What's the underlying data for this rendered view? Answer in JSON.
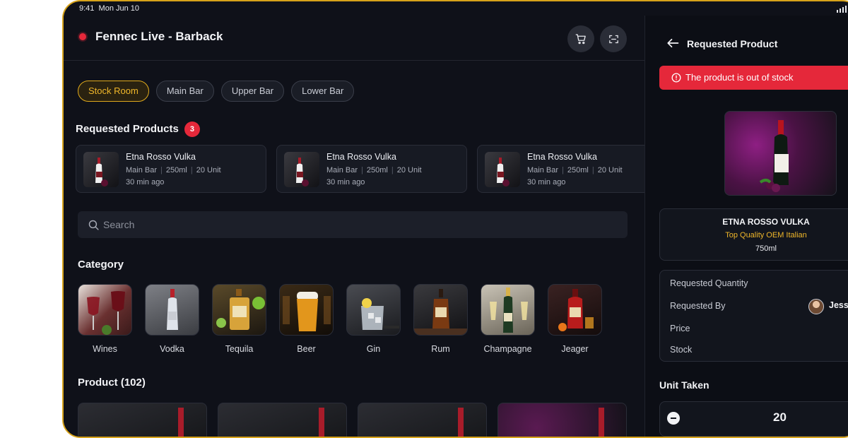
{
  "status_bar": {
    "time": "9:41",
    "date": "Mon Jun 10"
  },
  "header": {
    "title": "Fennec Live - Barback",
    "cart_icon": "cart-icon",
    "scan_icon": "scan-icon"
  },
  "locations": [
    {
      "label": "Stock Room",
      "active": true
    },
    {
      "label": "Main Bar",
      "active": false
    },
    {
      "label": "Upper Bar",
      "active": false
    },
    {
      "label": "Lower Bar",
      "active": false
    }
  ],
  "requested": {
    "title": "Requested Products",
    "count": "3",
    "items": [
      {
        "name": "Etna Rosso Vulka",
        "location": "Main Bar",
        "volume": "250ml",
        "units": "20 Unit",
        "time": "30 min ago"
      },
      {
        "name": "Etna Rosso Vulka",
        "location": "Main Bar",
        "volume": "250ml",
        "units": "20 Unit",
        "time": "30 min ago"
      },
      {
        "name": "Etna Rosso Vulka",
        "location": "Main Bar",
        "volume": "250ml",
        "units": "20 Unit",
        "time": "30 min ago"
      }
    ]
  },
  "search": {
    "placeholder": "Search"
  },
  "category": {
    "title": "Category",
    "items": [
      "Wines",
      "Vodka",
      "Tequila",
      "Beer",
      "Gin",
      "Rum",
      "Champagne",
      "Jeager"
    ]
  },
  "products": {
    "title": "Product (102)"
  },
  "panel": {
    "title": "Requested Product",
    "alert": "The product is out of stock",
    "product_name": "ETNA ROSSO VULKA",
    "product_subtitle": "Top Quality OEM Italian",
    "product_size": "750ml",
    "labels": {
      "requested_quantity": "Requested Quantity",
      "requested_by": "Requested By",
      "price": "Price",
      "stock": "Stock"
    },
    "requested_by_name": "Jesse",
    "unit_taken_title": "Unit Taken",
    "unit_taken_value": "20"
  },
  "colors": {
    "accent": "#f0b72a",
    "alert": "#e5283a",
    "background": "#0f1119"
  }
}
